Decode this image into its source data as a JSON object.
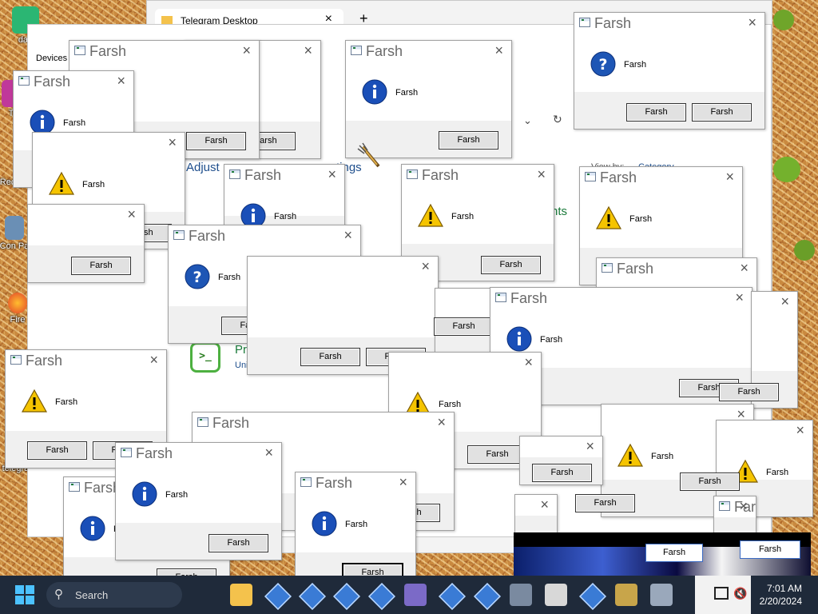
{
  "desktop": {
    "icons": [
      {
        "label": "dan"
      },
      {
        "label": "T"
      },
      {
        "label": "Rec Bi"
      },
      {
        "label": "Con Pa"
      },
      {
        "label": "Fire"
      },
      {
        "label": "telegram"
      }
    ]
  },
  "telegram_tab": {
    "title": "Telegram Desktop",
    "close": "×",
    "new_tab": "+"
  },
  "settings_window": {
    "devices_tab": "Devices",
    "link_adjust": "Adjust",
    "link_settings": "tings",
    "partial_nts": "nts",
    "view_by": "View by:",
    "view_by_value": "Category",
    "pro_label": "Pro",
    "uni_label": "Uni"
  },
  "dialog": {
    "title": "Farsh",
    "message": "Farsh",
    "button": "Farsh",
    "close": "×",
    "partial_title": "Far",
    "partial_msg_arsh": "arsh",
    "partial_msg_sh": "sh",
    "partial_msg_rsh": "rsh"
  },
  "taskbar": {
    "search_placeholder": "Search",
    "time": "7:01 AM",
    "date": "2/20/2024"
  },
  "colors": {
    "info_blue": "#1a4fb8",
    "warning_yellow": "#f5c400",
    "question_blue": "#1e56b5",
    "taskbar": "#1f2a3a"
  }
}
